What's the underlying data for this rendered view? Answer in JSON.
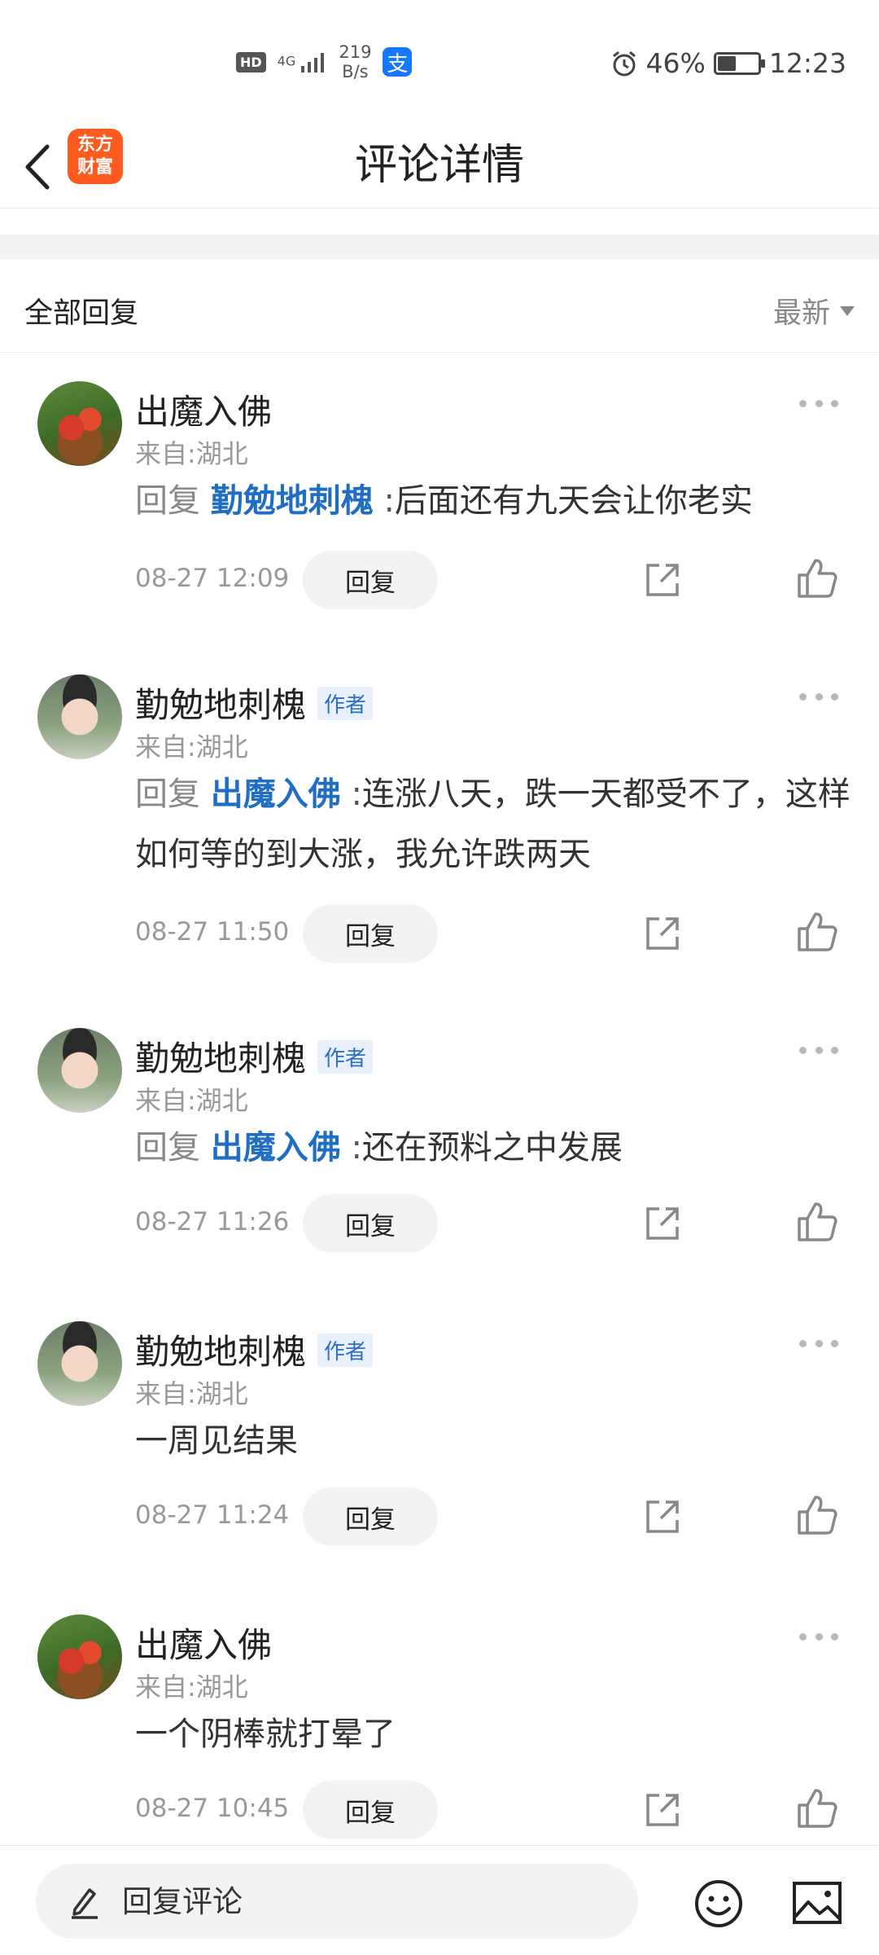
{
  "status_bar": {
    "hd": "HD",
    "network": "4G",
    "speed_value": "219",
    "speed_unit": "B/s",
    "alipay_glyph": "支",
    "battery_percent": "46%",
    "battery_level": 0.46,
    "time": "12:23"
  },
  "header": {
    "logo_line1": "东方",
    "logo_line2": "财富",
    "title": "评论详情"
  },
  "section": {
    "title": "全部回复",
    "sort_label": "最新"
  },
  "comments": [
    {
      "user": "出魔入佛",
      "avatar": "fruit-basket-avatar",
      "is_author": false,
      "location": "来自:湖北",
      "reply_label": "回复",
      "reply_to": "勤勉地刺槐",
      "colon": ":",
      "text": "后面还有九天会让你老实",
      "time": "08-27 12:09"
    },
    {
      "user": "勤勉地刺槐",
      "avatar": "portrait-avatar",
      "is_author": true,
      "location": "来自:湖北",
      "reply_label": "回复",
      "reply_to": "出魔入佛",
      "colon": ":",
      "text": "连涨八天，跌一天都受不了，这样如何等的到大涨，我允许跌两天",
      "time": "08-27 11:50"
    },
    {
      "user": "勤勉地刺槐",
      "avatar": "portrait-avatar",
      "is_author": true,
      "location": "来自:湖北",
      "reply_label": "回复",
      "reply_to": "出魔入佛",
      "colon": ":",
      "text": "还在预料之中发展",
      "time": "08-27 11:26"
    },
    {
      "user": "勤勉地刺槐",
      "avatar": "portrait-avatar",
      "is_author": true,
      "location": "来自:湖北",
      "text": "一周见结果",
      "time": "08-27 11:24"
    },
    {
      "user": "出魔入佛",
      "avatar": "fruit-basket-avatar",
      "is_author": false,
      "location": "来自:湖北",
      "text": "一个阴棒就打晕了",
      "time": "08-27 10:45"
    }
  ],
  "labels": {
    "author_badge": "作者",
    "reply_button": "回复"
  },
  "bottom_bar": {
    "placeholder": "回复评论"
  },
  "icons": {
    "back": "chevron-left-icon",
    "more": "more-dots-icon",
    "share": "share-icon",
    "like": "thumbs-up-icon",
    "edit": "pencil-icon",
    "emoji": "emoji-icon",
    "image": "image-icon"
  },
  "colors": {
    "reply_name": "#1f6ec4",
    "author_badge_bg": "#e7f0fb",
    "brand": "#ff5a1f"
  }
}
